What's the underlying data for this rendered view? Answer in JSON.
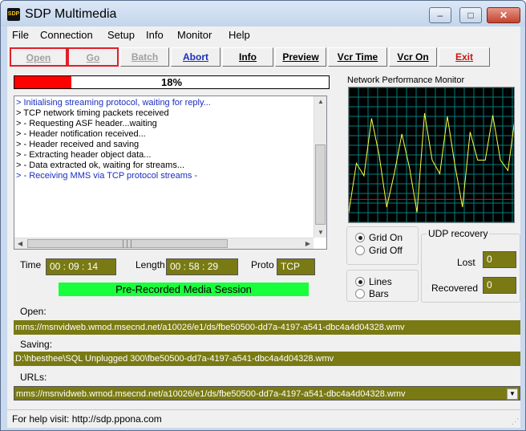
{
  "window": {
    "title": "SDP Multimedia",
    "icon": "sdp-app-icon",
    "icon_text": "SDP"
  },
  "menu": [
    "File",
    "Connection",
    "Setup",
    "Info",
    "Monitor",
    "Help"
  ],
  "toolbar": {
    "open": "Open",
    "go": "Go",
    "batch": "Batch",
    "abort": "Abort",
    "info": "Info",
    "preview": "Preview",
    "vcr_time": "Vcr Time",
    "vcr_on": "Vcr On",
    "exit": "Exit"
  },
  "progress": {
    "value": 0.18,
    "label": "18%",
    "fill_color": "#ff0000"
  },
  "log": [
    {
      "text": "> Initialising streaming protocol, waiting for reply...",
      "color": "blue"
    },
    {
      "text": "> TCP network timing packets received",
      "color": "black"
    },
    {
      "text": "> - Requesting ASF header...waiting",
      "color": "black"
    },
    {
      "text": "> - Header notification received...",
      "color": "black"
    },
    {
      "text": "> - Header received and saving",
      "color": "black"
    },
    {
      "text": "> - Extracting header object data...",
      "color": "black"
    },
    {
      "text": "> - Data extracted ok, waiting for streams...",
      "color": "black"
    },
    {
      "text": "> - Receiving MMS via TCP protocol streams -",
      "color": "blue"
    }
  ],
  "stats": {
    "time_label": "Time",
    "time_value": "00 : 09 : 14",
    "length_label": "Length",
    "length_value": "00 : 58 : 29",
    "proto_label": "Proto",
    "proto_value": "TCP"
  },
  "session": {
    "text": "Pre-Recorded Media Session",
    "color": "#19ff3c"
  },
  "perf": {
    "title": "Network Performance Monitor",
    "series": [
      5,
      52,
      40,
      95,
      60,
      10,
      42,
      80,
      48,
      5,
      100,
      55,
      42,
      97,
      50,
      10,
      82,
      55,
      55,
      98,
      55,
      45,
      100
    ],
    "grid_color": "#007f7f",
    "line_color": "#ffff40",
    "threshold_color": "#c81414",
    "threshold": 18
  },
  "grid_options": {
    "on": "Grid On",
    "off": "Grid Off",
    "selected": "on"
  },
  "draw_options": {
    "lines": "Lines",
    "bars": "Bars",
    "selected": "lines"
  },
  "udp": {
    "title": "UDP recovery",
    "lost_label": "Lost",
    "lost_value": "0",
    "recovered_label": "Recovered",
    "recovered_value": "0"
  },
  "paths": {
    "open_label": "Open:",
    "open_value": "mms://msnvidweb.wmod.msecnd.net/a10026/e1/ds/fbe50500-dd7a-4197-a541-dbc4a4d04328.wmv",
    "saving_label": "Saving:",
    "saving_value": "D:\\hbesthee\\SQL Unplugged 300\\fbe50500-dd7a-4197-a541-dbc4a4d04328.wmv",
    "urls_label": "URLs:",
    "urls_value": "mms://msnvidweb.wmod.msecnd.net/a10026/e1/ds/fbe50500-dd7a-4197-a541-dbc4a4d04328.wmv"
  },
  "status": {
    "text": "For help visit:  http://sdp.ppona.com"
  }
}
